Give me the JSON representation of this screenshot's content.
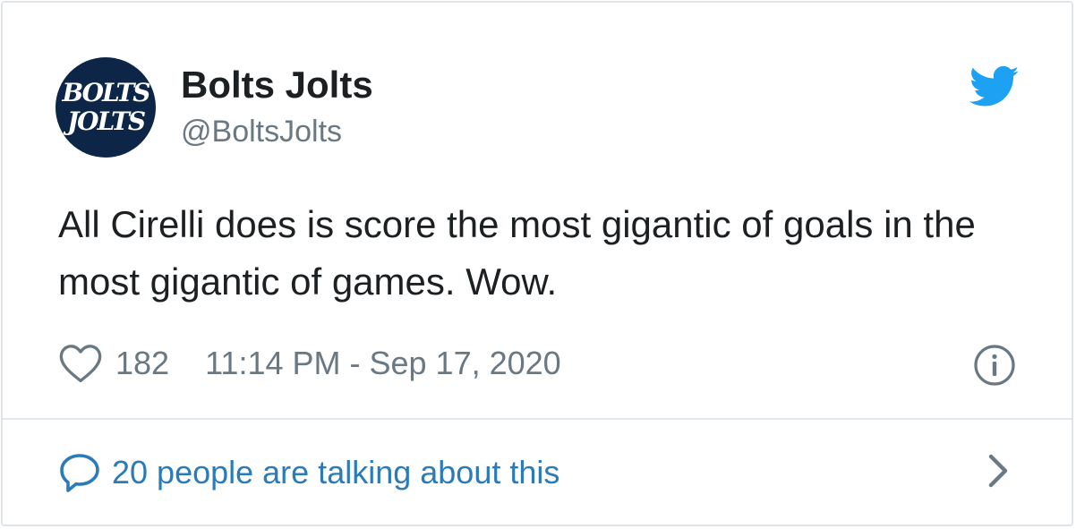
{
  "user": {
    "avatar_line1": "BOLTS",
    "avatar_line2": "JOLTS",
    "display_name": "Bolts Jolts",
    "handle": "@BoltsJolts"
  },
  "tweet": {
    "text": "All Cirelli does is score the most gigantic of goals in the most gigantic of games. Wow.",
    "likes": "182",
    "timestamp": "11:14 PM - Sep 17, 2020"
  },
  "footer": {
    "conversation_label": "20 people are talking about this"
  },
  "icons": {
    "brand": "twitter-bird-icon",
    "like": "heart-icon",
    "info": "info-icon",
    "conversation": "speech-bubble-icon",
    "more": "chevron-right-icon"
  },
  "colors": {
    "twitter_blue": "#1da1f2",
    "link_blue": "#2b7bb9",
    "text": "#1c2022",
    "muted": "#697882",
    "avatar_bg": "#0d2546"
  }
}
